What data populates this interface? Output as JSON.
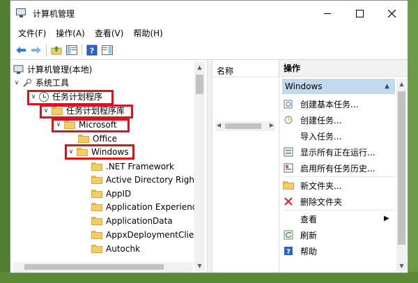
{
  "window": {
    "title": "计算机管理"
  },
  "menu": [
    "文件(F)",
    "操作(A)",
    "查看(V)",
    "帮助(H)"
  ],
  "toolbar_icons": [
    "back-arrow-icon",
    "forward-arrow-icon",
    "up-folder-icon",
    "show-tree-icon",
    "help-icon",
    "show-action-pane-icon"
  ],
  "tree": {
    "root": "计算机管理(本地)",
    "system_tools": "系统工具",
    "task_scheduler": "任务计划程序",
    "task_library": "任务计划程序库",
    "microsoft": "Microsoft",
    "office": "Office",
    "windows": "Windows",
    "windows_children": [
      ".NET Framework",
      "Active Directory Rights",
      "AppID",
      "Application Experience",
      "ApplicationData",
      "AppxDeploymentClien",
      "Autochk"
    ]
  },
  "middle": {
    "column_header": "名称"
  },
  "actions": {
    "header": "操作",
    "section": "Windows",
    "items": [
      "创建基本任务...",
      "创建任务...",
      "导入任务...",
      "显示所有正在运行...",
      "启用所有任务历史...",
      "新文件夹...",
      "删除文件夹",
      "查看",
      "刷新",
      "帮助"
    ]
  },
  "colors": {
    "highlight": "#e0101d",
    "section_bg": "#c4d8ee",
    "nav_arrow": "#2e7bd6"
  }
}
